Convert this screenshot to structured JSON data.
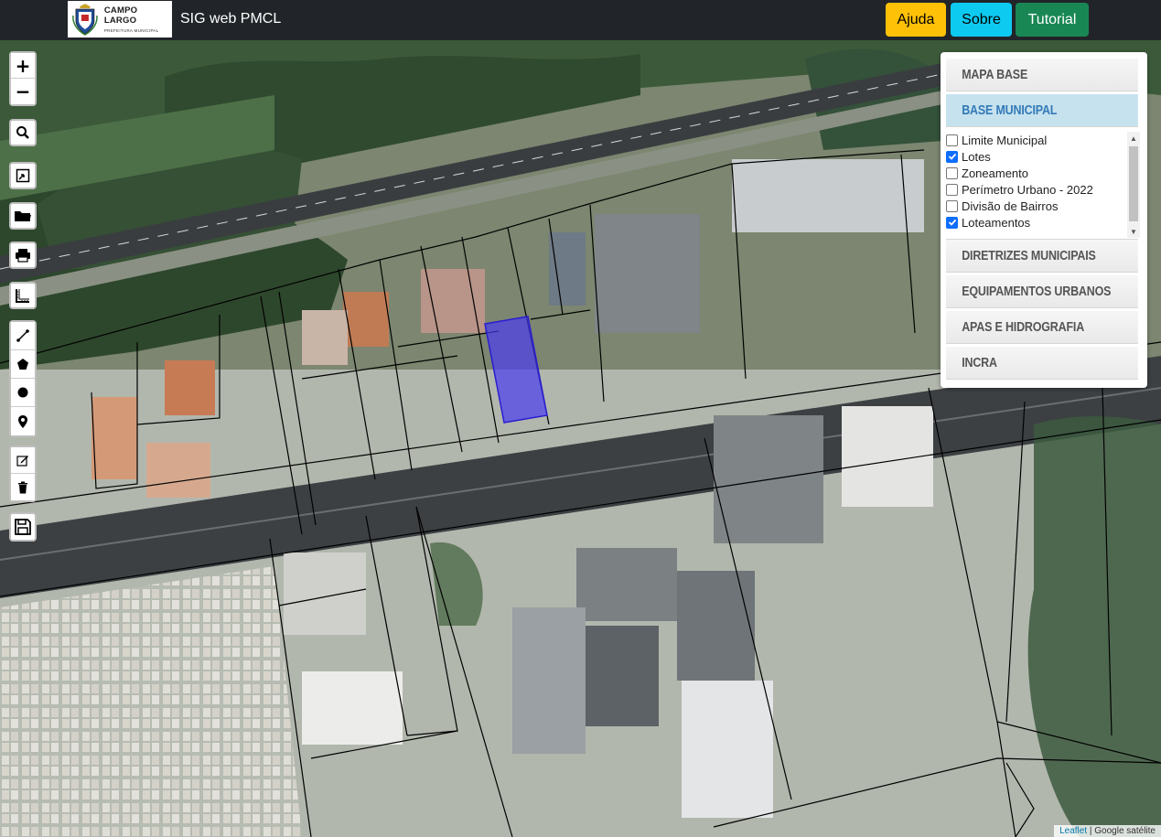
{
  "navbar": {
    "logo_city": "CAMPO LARGO",
    "logo_sub": "PREFEITURA MUNICIPAL",
    "title": "SIG web PMCL",
    "buttons": {
      "ajuda": "Ajuda",
      "sobre": "Sobre",
      "tutorial": "Tutorial"
    }
  },
  "map_controls": {
    "zoom_in": "+",
    "zoom_out": "−"
  },
  "layer_panel": {
    "sections": {
      "mapa_base": "Mapa Base",
      "base_municipal": "Base Municipal",
      "diretrizes": "Diretrizes Municipais",
      "equipamentos": "Equipamentos Urbanos",
      "apas": "APAs e Hidrografia",
      "incra": "INCRA"
    },
    "layers": [
      {
        "label": "Limite Municipal",
        "checked": false
      },
      {
        "label": "Lotes",
        "checked": true
      },
      {
        "label": "Zoneamento",
        "checked": false
      },
      {
        "label": "Perímetro Urbano - 2022",
        "checked": false
      },
      {
        "label": "Divisão de Bairros",
        "checked": false
      },
      {
        "label": "Loteamentos",
        "checked": true
      }
    ]
  },
  "attribution": {
    "leaflet": "Leaflet",
    "separator": " | ",
    "imagery": "Google satélite"
  },
  "colors": {
    "selected_parcel": "#4a3cf0",
    "navbar": "#212529",
    "ajuda": "#ffc107",
    "sobre": "#0dcaf0",
    "tutorial": "#198754",
    "active_section": "#c6e2ee"
  }
}
